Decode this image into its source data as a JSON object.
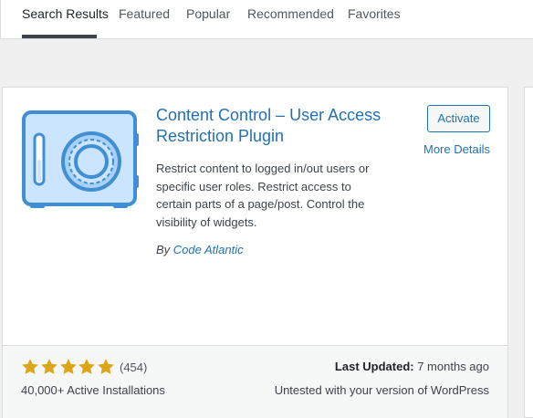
{
  "tabs": [
    {
      "label": "Search Results",
      "active": true
    },
    {
      "label": "Featured",
      "active": false
    },
    {
      "label": "Popular",
      "active": false
    },
    {
      "label": "Recommended",
      "active": false
    },
    {
      "label": "Favorites",
      "active": false
    }
  ],
  "plugin": {
    "title": "Content Control – User Access Restriction Plugin",
    "description": "Restrict content to logged in/out users or specific user roles. Restrict access to certain parts of a page/post. Control the visibility of widgets.",
    "author_prefix": "By",
    "author_name": "Code Atlantic",
    "icon": "safe-vault-icon",
    "activate_label": "Activate",
    "more_details_label": "More Details",
    "rating": 5,
    "rating_count": "(454)",
    "installs": "40,000+ Active Installations",
    "last_updated_label": "Last Updated:",
    "last_updated_value": "7 months ago",
    "compatibility": "Untested with your version of WordPress"
  },
  "colors": {
    "link": "#2271b1",
    "star": "#dba617",
    "icon_fill": "#cce5ff",
    "icon_stroke": "#3f8fd2"
  }
}
